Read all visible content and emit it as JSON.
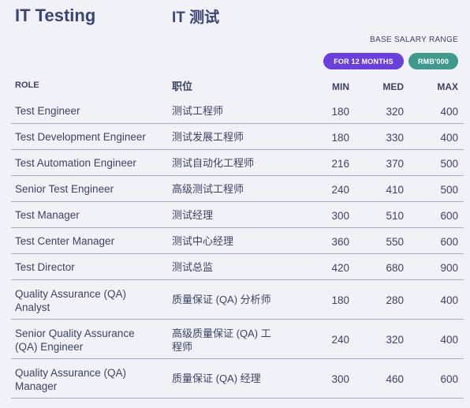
{
  "header": {
    "title_en": "IT Testing",
    "title_cn": "IT 测试",
    "salary_range_label": "BASE SALARY RANGE",
    "period_pill": "FOR 12 MONTHS",
    "currency_pill": "RMB'000"
  },
  "columns": {
    "role": "ROLE",
    "role_cn": "职位",
    "min": "MIN",
    "med": "MED",
    "max": "MAX"
  },
  "rows": [
    {
      "role": "Test Engineer",
      "role_cn": "测试工程师",
      "min": "180",
      "med": "320",
      "max": "400"
    },
    {
      "role": "Test Development Engineer",
      "role_cn": "测试发展工程师",
      "min": "180",
      "med": "330",
      "max": "400"
    },
    {
      "role": "Test Automation Engineer",
      "role_cn": "测试自动化工程师",
      "min": "216",
      "med": "370",
      "max": "500"
    },
    {
      "role": "Senior Test Engineer",
      "role_cn": "高级测试工程师",
      "min": "240",
      "med": "410",
      "max": "500"
    },
    {
      "role": "Test Manager",
      "role_cn": "测试经理",
      "min": "300",
      "med": "510",
      "max": "600"
    },
    {
      "role": "Test Center Manager",
      "role_cn": "测试中心经理",
      "min": "360",
      "med": "550",
      "max": "600"
    },
    {
      "role": "Test Director",
      "role_cn": "测试总监",
      "min": "420",
      "med": "680",
      "max": "900"
    },
    {
      "role": "Quality Assurance (QA)\nAnalyst",
      "role_cn": "质量保证 (QA) 分析师",
      "min": "180",
      "med": "280",
      "max": "400"
    },
    {
      "role": "Senior Quality Assurance\n(QA) Engineer",
      "role_cn": "高级质量保证 (QA) 工\n程师",
      "min": "240",
      "med": "320",
      "max": "400"
    },
    {
      "role": "Quality Assurance (QA)\nManager",
      "role_cn": "质量保证 (QA) 经理",
      "min": "300",
      "med": "460",
      "max": "600"
    }
  ]
}
